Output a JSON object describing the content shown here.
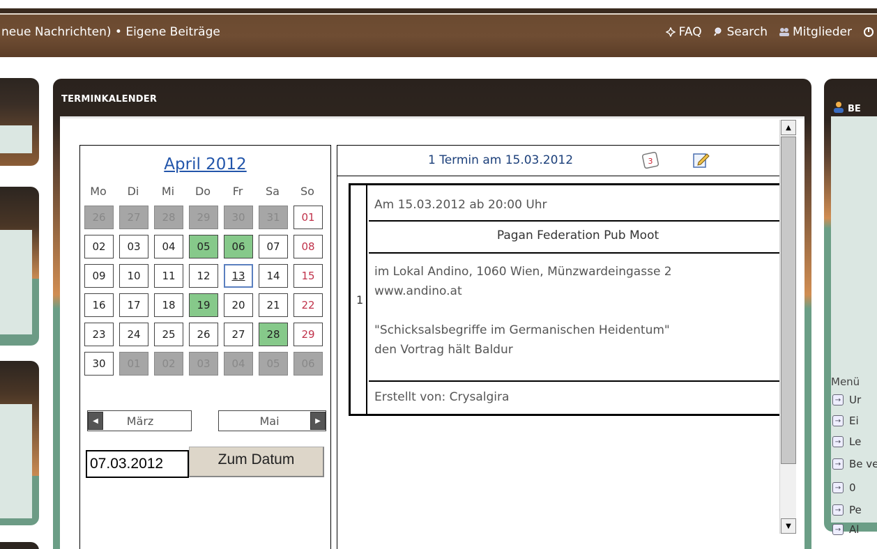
{
  "topbar": {
    "left_text": "neue Nachrichten) • Eigene Beiträge",
    "faq": "FAQ",
    "search": "Search",
    "members": "Mitglieder"
  },
  "main": {
    "title": "TERMINKALENDER"
  },
  "calendar": {
    "month_label": "April 2012",
    "weekdays": [
      "Mo",
      "Di",
      "Mi",
      "Do",
      "Fr",
      "Sa",
      "So"
    ],
    "weeks": [
      [
        "26",
        "27",
        "28",
        "29",
        "30",
        "31",
        "01"
      ],
      [
        "02",
        "03",
        "04",
        "05",
        "06",
        "07",
        "08"
      ],
      [
        "09",
        "10",
        "11",
        "12",
        "13",
        "14",
        "15"
      ],
      [
        "16",
        "17",
        "18",
        "19",
        "20",
        "21",
        "22"
      ],
      [
        "23",
        "24",
        "25",
        "26",
        "27",
        "28",
        "29"
      ],
      [
        "30",
        "01",
        "02",
        "03",
        "04",
        "05",
        "06"
      ]
    ],
    "other_month_days": [
      [
        0,
        0
      ],
      [
        0,
        1
      ],
      [
        0,
        2
      ],
      [
        0,
        3
      ],
      [
        0,
        4
      ],
      [
        0,
        5
      ],
      [
        5,
        1
      ],
      [
        5,
        2
      ],
      [
        5,
        3
      ],
      [
        5,
        4
      ],
      [
        5,
        5
      ],
      [
        5,
        6
      ]
    ],
    "event_days": [
      [
        1,
        3
      ],
      [
        1,
        4
      ],
      [
        3,
        3
      ],
      [
        4,
        5
      ]
    ],
    "today": [
      2,
      4
    ],
    "prev_month": "März",
    "next_month": "Mai",
    "date_value": "07.03.2012",
    "go_button": "Zum Datum"
  },
  "event_panel": {
    "header": "1 Termin am 15.03.2012",
    "index": "1",
    "time": "Am 15.03.2012 ab 20:00 Uhr",
    "title": "Pagan Federation Pub Moot",
    "location": "im Lokal Andino, 1060 Wien, Münzwardeingasse 2",
    "website": "www.andino.at",
    "talk": "\"Schicksalsbegriffe im Germanischen Heidentum\"",
    "speaker": "den Vortrag hält Baldur",
    "author": "Erstellt von: Crysalgira"
  },
  "right_panel": {
    "title": "BE",
    "menu_label": "Menü",
    "items": [
      "Ur",
      "Ei",
      "Le",
      "Be ve",
      "0",
      "Pe",
      "Al"
    ]
  },
  "colors": {
    "event_day": "#86c98a",
    "sunday_text": "#c0324a",
    "link_blue": "#2255aa"
  }
}
